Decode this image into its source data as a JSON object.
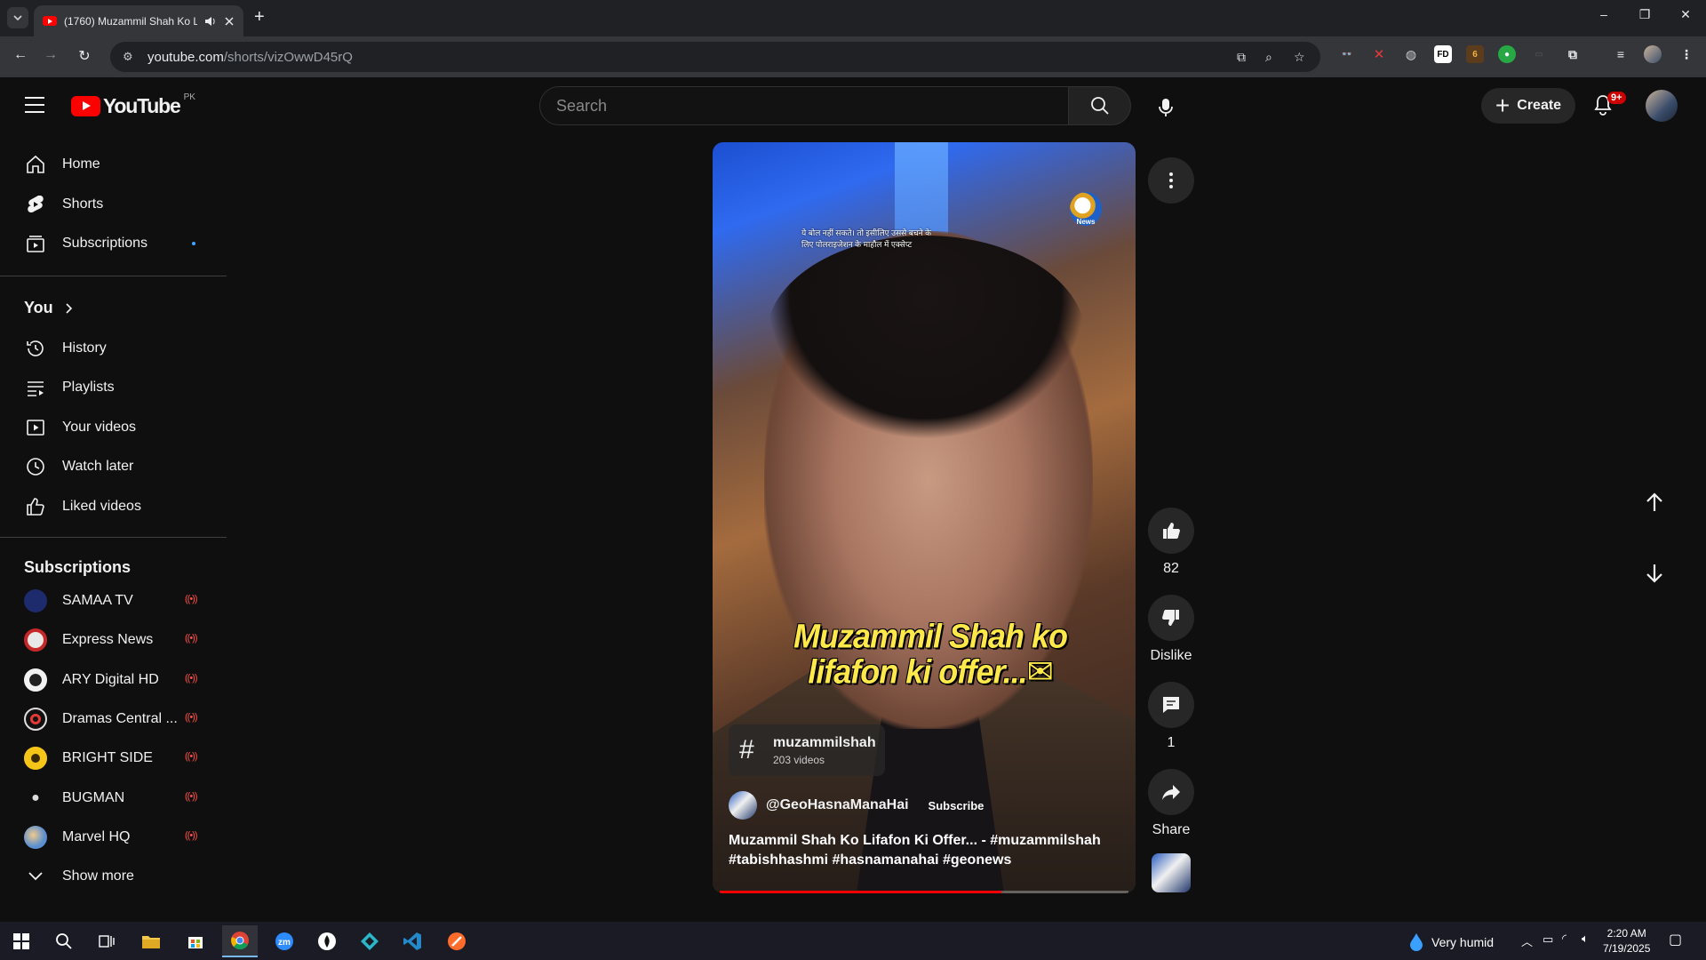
{
  "browser": {
    "tab_title": "(1760) Muzammil Shah Ko L",
    "url_host": "youtube.com",
    "url_path": "/shorts/vizOwwD45rQ"
  },
  "header": {
    "logo_text": "YouTube",
    "country_code": "PK",
    "search_placeholder": "Search",
    "create_label": "Create",
    "notification_badge": "9+"
  },
  "sidebar": {
    "main": [
      {
        "label": "Home",
        "icon": "home-icon"
      },
      {
        "label": "Shorts",
        "icon": "shorts-icon"
      },
      {
        "label": "Subscriptions",
        "icon": "subscriptions-icon"
      }
    ],
    "you_heading": "You",
    "you_items": [
      {
        "label": "History",
        "icon": "history-icon"
      },
      {
        "label": "Playlists",
        "icon": "playlists-icon"
      },
      {
        "label": "Your videos",
        "icon": "your-videos-icon"
      },
      {
        "label": "Watch later",
        "icon": "watch-later-icon"
      },
      {
        "label": "Liked videos",
        "icon": "liked-videos-icon"
      }
    ],
    "subs_heading": "Subscriptions",
    "subscriptions": [
      {
        "label": "SAMAA TV",
        "color": "#1d2a6b"
      },
      {
        "label": "Express News",
        "color": "#e8e8e8"
      },
      {
        "label": "ARY Digital HD",
        "color": "#f2f2f2"
      },
      {
        "label": "Dramas Central ...",
        "color": "#111111"
      },
      {
        "label": "BRIGHT SIDE",
        "color": "#f5c518"
      },
      {
        "label": "BUGMAN",
        "color": "#0f0f0f"
      },
      {
        "label": "Marvel HQ",
        "color": "#5a8fd0"
      }
    ],
    "live_icon": "((•))",
    "show_more": "Show more"
  },
  "short": {
    "overlay_text_top": "ये बोल नहीं सकते। तो इसीलिए उससे बचने के लिए पोलराइजेशन के माहौल में एक्सेप्ट",
    "caption_line1": "Muzammil Shah ko",
    "caption_line2": "lifafon ki offer...✉",
    "watermark": "News",
    "hashtag_name": "muzammilshah",
    "hashtag_count": "203 videos",
    "channel_handle": "@GeoHasnaManaHai",
    "subscribe_label": "Subscribe",
    "description_line1": "Muzammil Shah Ko Lifafon Ki Offer... - #muzammilshah",
    "description_line2": "#tabishhashmi #hasnamanahai #geonews",
    "progress": 0.69
  },
  "actions": {
    "likes": "82",
    "dislike_label": "Dislike",
    "comments": "1",
    "share_label": "Share"
  },
  "taskbar": {
    "weather": "Very humid",
    "time": "2:20 AM",
    "date": "7/19/2025"
  }
}
